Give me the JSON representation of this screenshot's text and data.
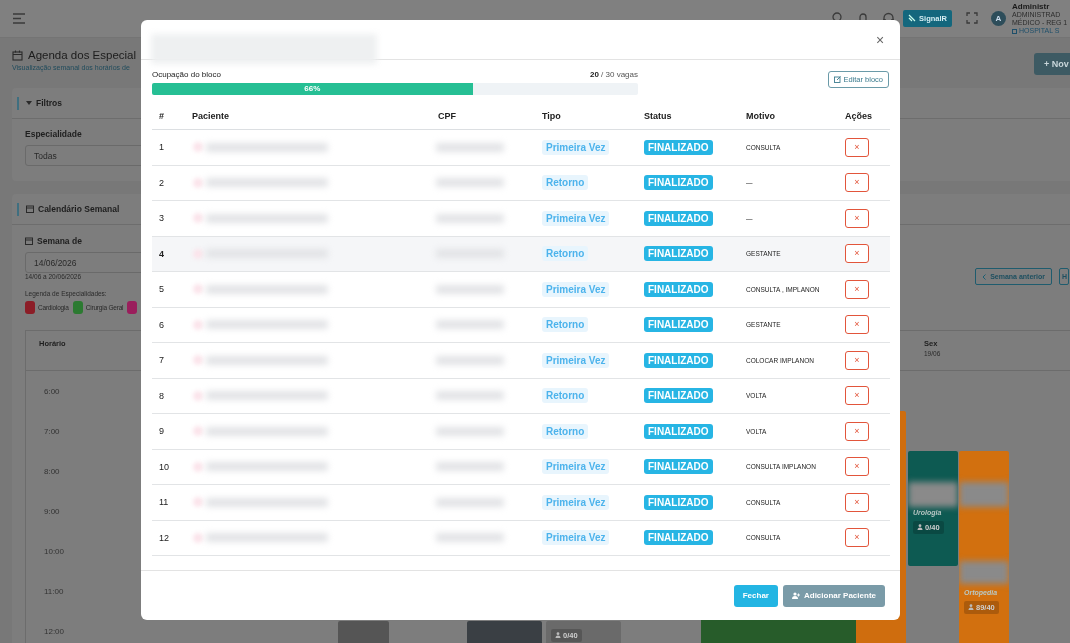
{
  "topbar": {
    "signal_button": "SignalR",
    "avatar": "A",
    "user": {
      "name": "Administr",
      "role": "ADMINISTRAD",
      "registry": "MÉDICO - REG 1",
      "unit": "HOSPITAL S"
    }
  },
  "page": {
    "title": "Agenda dos Especial",
    "subtitle": "Visualização semanal dos horários de",
    "new_button": "+ Nov"
  },
  "filters": {
    "title": "Filtros",
    "specialty_label": "Especialidade",
    "specialty_value": "Todas"
  },
  "calendar": {
    "title": "Calendário Semanal",
    "week_label": "Semana de",
    "week_value": "14/06/2026",
    "week_range": "14/06 a 20/06/2026",
    "legend_label": "Legenda de Especialidades:",
    "legend": [
      {
        "name": "Cardiologia",
        "color": "#8c1d27"
      },
      {
        "name": "Cirurgia Geral",
        "color": "#2c7a31"
      },
      {
        "color": "#9a1e5c"
      }
    ],
    "prev_button": "Semana anterior",
    "next_button": "H",
    "time_header": "Horário",
    "day_header": {
      "name": "Sex",
      "date": "19/06"
    },
    "times": [
      "6:00",
      "7:00",
      "8:00",
      "9:00",
      "10:00",
      "11:00",
      "12:00"
    ],
    "events": [
      {
        "color": "#0d5a52",
        "label": "Urologia",
        "count": "0/40"
      },
      {
        "color": "#d2700f",
        "label": "Ortopedia",
        "count": "89/40"
      },
      {
        "color": "#cf6d0e"
      },
      {
        "color": "#275c2a"
      },
      {
        "color": "#555555"
      },
      {
        "color": "#3a3f44"
      },
      {
        "color": "#6a6a6a",
        "count": "0/40"
      }
    ]
  },
  "modal": {
    "close": "×",
    "occupancy": {
      "label": "Ocupação do bloco",
      "filled": "20",
      "capacity": "/ 30 vagas",
      "level": 0.66,
      "percent": "66%"
    },
    "edit_button": "Editar bloco",
    "columns": [
      "#",
      "Paciente",
      "CPF",
      "Tipo",
      "Status",
      "Motivo",
      "Ações"
    ],
    "rows": [
      {
        "number": "1",
        "type": "Primeira Vez",
        "status": "FINALIZADO",
        "reason": "CONSULTA",
        "action": "×",
        "highlighted": false
      },
      {
        "number": "2",
        "type": "Retorno",
        "status": "FINALIZADO",
        "reason": "—",
        "action": "×",
        "highlighted": false
      },
      {
        "number": "3",
        "type": "Primeira Vez",
        "status": "FINALIZADO",
        "reason": "—",
        "action": "×",
        "highlighted": false
      },
      {
        "number": "4",
        "type": "Retorno",
        "status": "FINALIZADO",
        "reason": "GESTANTE",
        "action": "×",
        "highlighted": true
      },
      {
        "number": "5",
        "type": "Primeira Vez",
        "status": "FINALIZADO",
        "reason": "CONSULTA , IMPLANON",
        "action": "×",
        "highlighted": false
      },
      {
        "number": "6",
        "type": "Retorno",
        "status": "FINALIZADO",
        "reason": "GESTANTE",
        "action": "×",
        "highlighted": false
      },
      {
        "number": "7",
        "type": "Primeira Vez",
        "status": "FINALIZADO",
        "reason": "COLOCAR IMPLANON",
        "action": "×",
        "highlighted": false
      },
      {
        "number": "8",
        "type": "Retorno",
        "status": "FINALIZADO",
        "reason": "VOLTA",
        "action": "×",
        "highlighted": false
      },
      {
        "number": "9",
        "type": "Retorno",
        "status": "FINALIZADO",
        "reason": "VOLTA",
        "action": "×",
        "highlighted": false
      },
      {
        "number": "10",
        "type": "Primeira Vez",
        "status": "FINALIZADO",
        "reason": "CONSULTA IMPLANON",
        "action": "×",
        "highlighted": false
      },
      {
        "number": "11",
        "type": "Primeira Vez",
        "status": "FINALIZADO",
        "reason": "CONSULTA",
        "action": "×",
        "highlighted": false
      },
      {
        "number": "12",
        "type": "Primeira Vez",
        "status": "FINALIZADO",
        "reason": "CONSULTA",
        "action": "×",
        "highlighted": false
      }
    ],
    "buttons": {
      "close": "Fechar",
      "add": "Adicionar Paciente"
    }
  }
}
